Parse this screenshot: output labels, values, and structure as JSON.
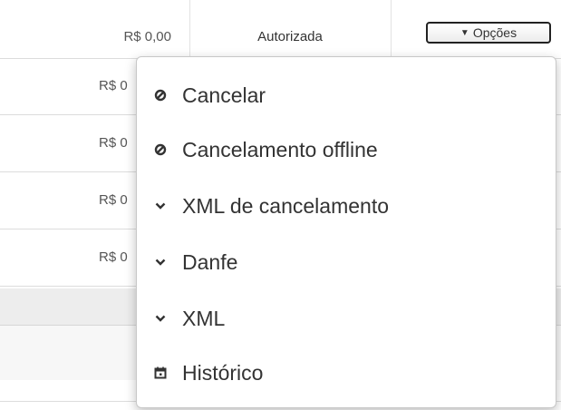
{
  "table": {
    "rows": [
      {
        "value": "R$ 0,00",
        "status": "Autorizada"
      },
      {
        "value": "R$ 0",
        "status": ""
      },
      {
        "value": "R$ 0",
        "status": ""
      },
      {
        "value": "R$ 0",
        "status": ""
      },
      {
        "value": "R$ 0",
        "status": ""
      }
    ]
  },
  "options_button": {
    "label": "Opções",
    "icon": "caret-down-icon"
  },
  "menu": {
    "items": [
      {
        "label": "Cancelar",
        "icon": "ban-icon"
      },
      {
        "label": "Cancelamento offline",
        "icon": "ban-icon"
      },
      {
        "label": "XML de cancelamento",
        "icon": "chevron-down-icon"
      },
      {
        "label": "Danfe",
        "icon": "chevron-down-icon"
      },
      {
        "label": "XML",
        "icon": "chevron-down-icon"
      },
      {
        "label": "Histórico",
        "icon": "calendar-icon"
      }
    ]
  }
}
